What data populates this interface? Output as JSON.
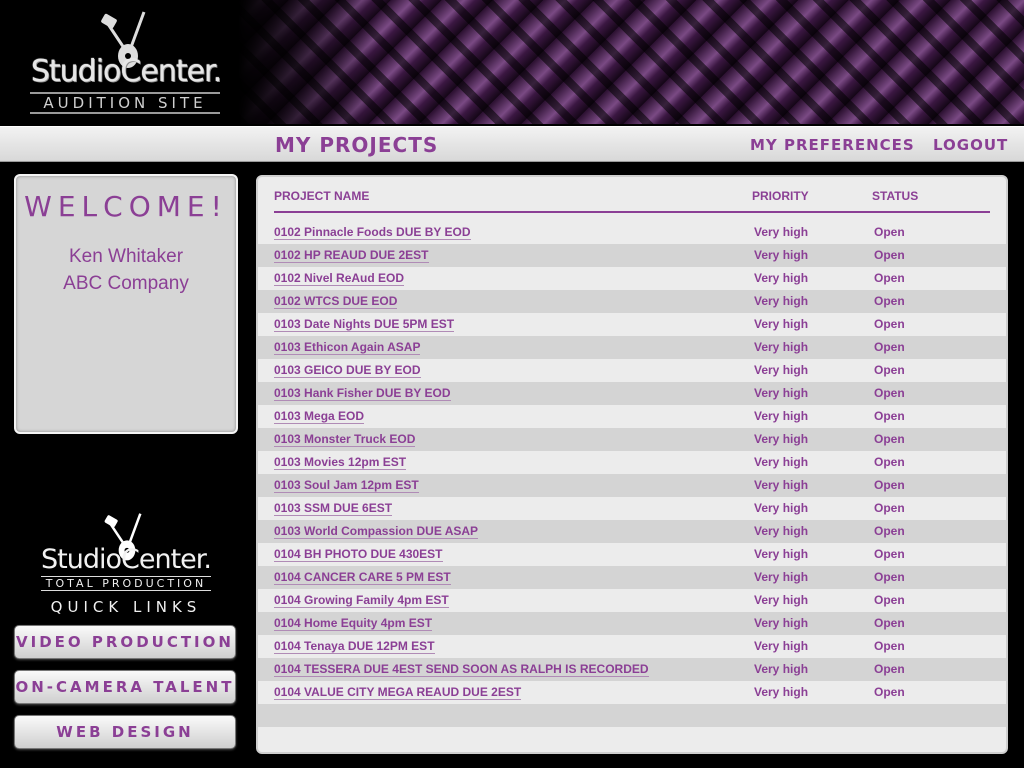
{
  "header": {
    "logo_brand": "StudioCenter.",
    "logo_sub": "AUDITION SITE"
  },
  "nav": {
    "title": "MY PROJECTS",
    "preferences": "MY PREFERENCES",
    "logout": "LOGOUT"
  },
  "welcome": {
    "title": "WELCOME!",
    "name": "Ken Whitaker",
    "company": "ABC Company"
  },
  "sidebar": {
    "logo_brand": "StudioCenter.",
    "logo_sub": "TOTAL PRODUCTION",
    "quick_links_label": "QUICK LINKS",
    "buttons": [
      {
        "label": "VIDEO PRODUCTION"
      },
      {
        "label": "ON-CAMERA TALENT"
      },
      {
        "label": "WEB DESIGN"
      }
    ]
  },
  "table": {
    "columns": {
      "name": "PROJECT NAME",
      "priority": "PRIORITY",
      "status": "STATUS"
    },
    "rows": [
      {
        "name": "0102 Pinnacle Foods DUE BY EOD",
        "priority": "Very high",
        "status": "Open"
      },
      {
        "name": "0102 HP REAUD DUE 2EST",
        "priority": "Very high",
        "status": "Open"
      },
      {
        "name": "0102 Nivel ReAud EOD",
        "priority": "Very high",
        "status": "Open"
      },
      {
        "name": "0102 WTCS DUE EOD",
        "priority": "Very high",
        "status": "Open"
      },
      {
        "name": "0103 Date Nights DUE 5PM EST",
        "priority": "Very high",
        "status": "Open"
      },
      {
        "name": "0103 Ethicon Again ASAP",
        "priority": "Very high",
        "status": "Open"
      },
      {
        "name": "0103 GEICO DUE BY EOD",
        "priority": "Very high",
        "status": "Open"
      },
      {
        "name": "0103 Hank Fisher DUE BY EOD",
        "priority": "Very high",
        "status": "Open"
      },
      {
        "name": "0103 Mega EOD",
        "priority": "Very high",
        "status": "Open"
      },
      {
        "name": "0103 Monster Truck EOD",
        "priority": "Very high",
        "status": "Open"
      },
      {
        "name": "0103 Movies 12pm EST",
        "priority": "Very high",
        "status": "Open"
      },
      {
        "name": "0103 Soul Jam 12pm EST",
        "priority": "Very high",
        "status": "Open"
      },
      {
        "name": "0103 SSM DUE 6EST",
        "priority": "Very high",
        "status": "Open"
      },
      {
        "name": "0103 World Compassion DUE ASAP",
        "priority": "Very high",
        "status": "Open"
      },
      {
        "name": "0104 BH PHOTO DUE 430EST",
        "priority": "Very high",
        "status": "Open"
      },
      {
        "name": "0104 CANCER CARE 5 PM EST",
        "priority": "Very high",
        "status": "Open"
      },
      {
        "name": "0104 Growing Family 4pm EST",
        "priority": "Very high",
        "status": "Open"
      },
      {
        "name": "0104 Home Equity 4pm EST",
        "priority": "Very high",
        "status": "Open"
      },
      {
        "name": "0104 Tenaya DUE 12PM EST",
        "priority": "Very high",
        "status": "Open"
      },
      {
        "name": "0104 TESSERA DUE 4EST SEND SOON AS RALPH IS RECORDED",
        "priority": "Very high",
        "status": "Open"
      },
      {
        "name": "0104 VALUE CITY MEGA REAUD DUE 2EST",
        "priority": "Very high",
        "status": "Open"
      }
    ]
  },
  "colors": {
    "accent": "#8b3f95",
    "panel_bg": "#ececec",
    "row_alt": "#d4d4d4"
  },
  "icons": {
    "logo_mark": "microphone-guitar-icon"
  }
}
